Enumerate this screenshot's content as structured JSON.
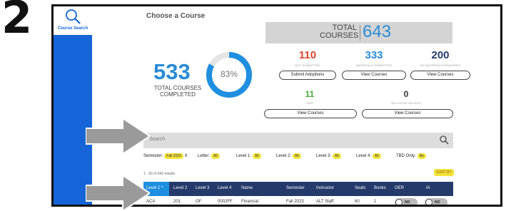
{
  "step_number": "2",
  "sidebar": {
    "course_search_label": "Course Search",
    "icon": "search-icon"
  },
  "page": {
    "title": "Choose a Course"
  },
  "totals": {
    "label_line1": "TOTAL",
    "label_line2": "COURSES",
    "value": "643"
  },
  "completed": {
    "value": "533",
    "label_line1": "TOTAL COURSES",
    "label_line2": "COMPLETED",
    "percent": "83%",
    "fraction": 0.83
  },
  "stats": {
    "adoptions": {
      "value": "110",
      "caption": "NOT SUBMITTED",
      "button": "Submit Adoptions",
      "color": "#d9462b"
    },
    "submitted": {
      "value": "333",
      "caption": "MATERIALS SUBMITTED",
      "button": "View Courses",
      "color": "#2a8bd6"
    },
    "required": {
      "value": "200",
      "caption": "NO MATERIALS REQUIRED",
      "button": "View Courses",
      "color": "#243a6a"
    },
    "oer": {
      "value": "11",
      "caption": "OER",
      "button": "View Courses",
      "color": "#4aa83a"
    },
    "inclusive": {
      "value": "0",
      "caption": "INCLUSIVE ACCESS",
      "button": "View Courses",
      "color": "#333333"
    }
  },
  "search": {
    "placeholder": "Search"
  },
  "filters": {
    "semester_label": "Semester:",
    "semester_value": "Fall 2023",
    "clear": "X",
    "letter_label": "Letter:",
    "letter_value": "All",
    "level1_label": "Level 1:",
    "level1_value": "All",
    "level2_label": "Level 2:",
    "level2_value": "All",
    "level3_label": "Level 3:",
    "level3_value": "All",
    "level4_label": "Level 4:",
    "level4_value": "All",
    "tbd_label": "TBD Only:",
    "tbd_value": "No"
  },
  "results": {
    "count_text": "1 - 50 of 643 results",
    "sort_label": "SORT BY"
  },
  "table": {
    "headers": [
      "Level 1 ^",
      "Level 2",
      "Level 3",
      "Level 4",
      "Name",
      "Semester",
      "Instructor",
      "Seats",
      "Books",
      "OER",
      "IA"
    ],
    "row": {
      "level1": "ACA",
      "level2": "201",
      "level3": "OF",
      "level4": "0002FF",
      "name": "Financial",
      "semester": "Fall 2023",
      "instructor": "ALT Staff",
      "seats": "60",
      "books": "1",
      "oer": "NO",
      "ia": "NO"
    }
  },
  "colors": {
    "accent": "#2a8bd6",
    "sidebar": "#1565d8",
    "header": "#243a6a",
    "pill": "#f1e33b"
  }
}
